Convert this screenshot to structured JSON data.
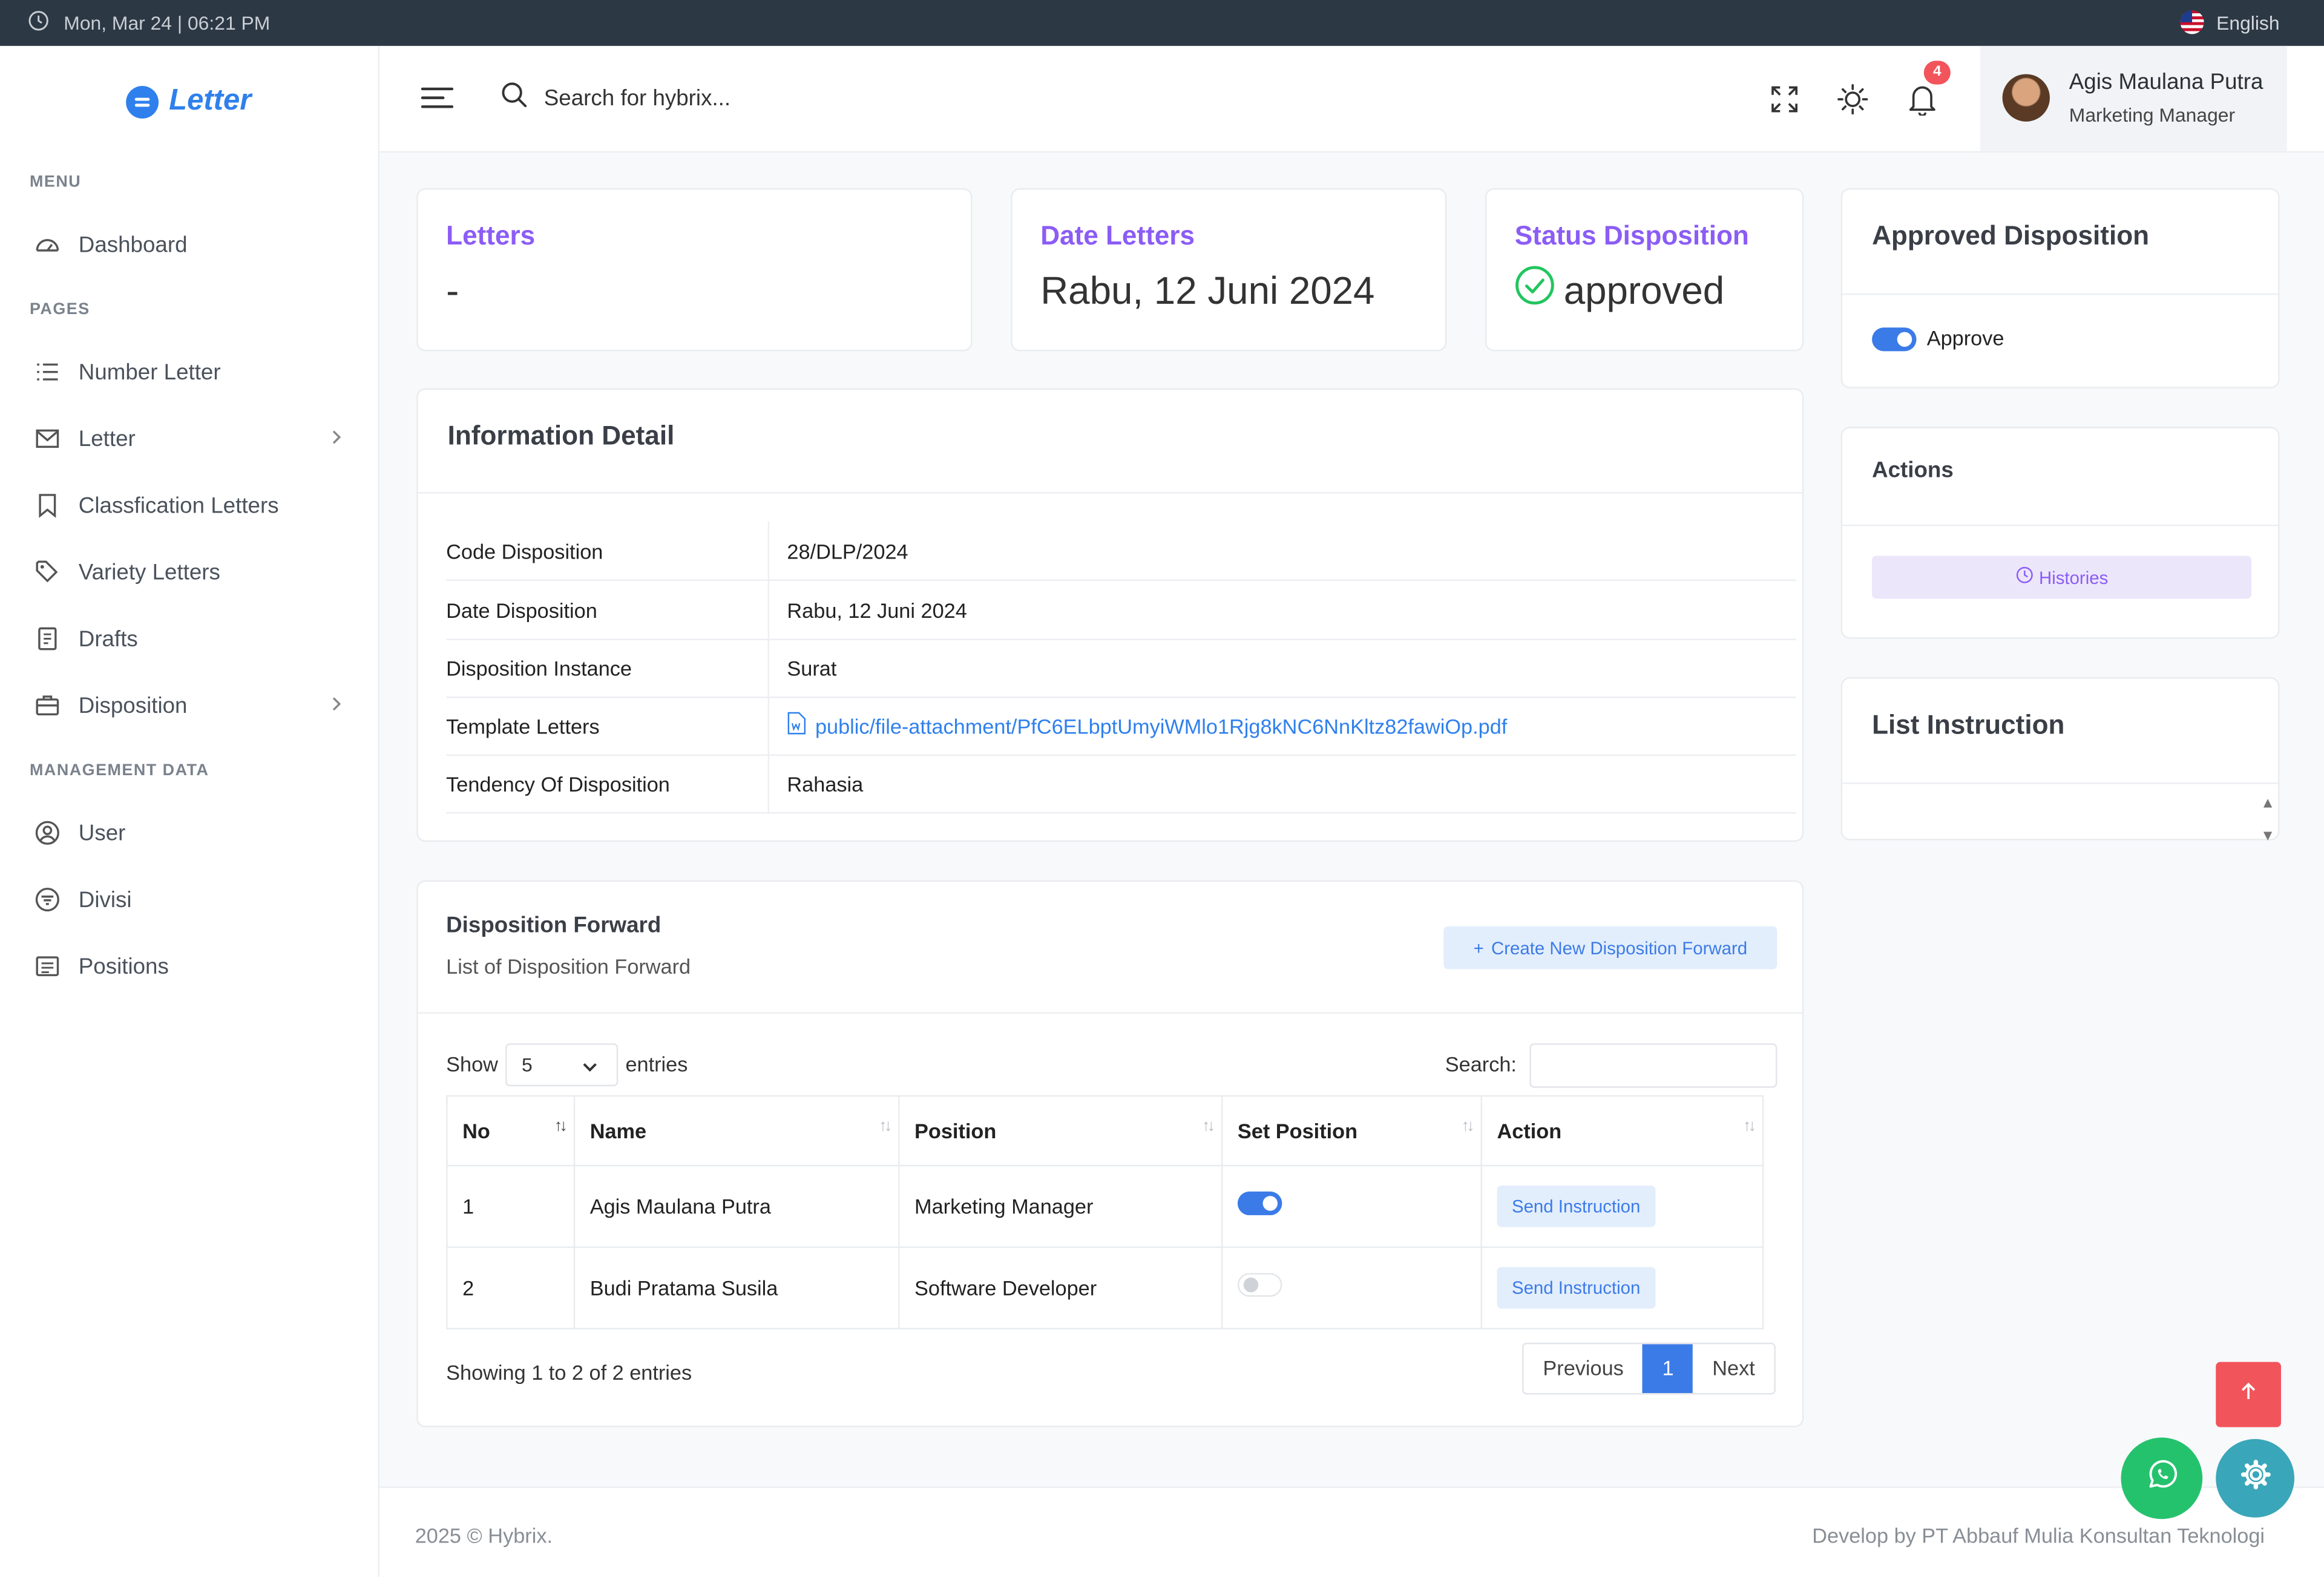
{
  "topbar": {
    "datetime": "Mon, Mar 24 | 06:21 PM",
    "language": "English"
  },
  "brand": {
    "name": "Letter"
  },
  "sidebar": {
    "sections": {
      "menu": "MENU",
      "pages": "PAGES",
      "management": "MANAGEMENT DATA"
    },
    "items": {
      "dashboard": "Dashboard",
      "number_letter": "Number Letter",
      "letter": "Letter",
      "classification": "Classfication Letters",
      "variety": "Variety Letters",
      "drafts": "Drafts",
      "disposition": "Disposition",
      "user": "User",
      "divisi": "Divisi",
      "positions": "Positions"
    }
  },
  "header": {
    "search_placeholder": "Search for hybrix...",
    "notification_count": "4",
    "user_name": "Agis Maulana Putra",
    "user_role": "Marketing Manager"
  },
  "stats": {
    "letters": {
      "label": "Letters",
      "value": "-"
    },
    "date": {
      "label": "Date Letters",
      "value": "Rabu, 12 Juni 2024"
    },
    "status": {
      "label": "Status Disposition",
      "value": "approved"
    }
  },
  "approved": {
    "title": "Approved Disposition",
    "toggle_label": "Approve",
    "toggle_on": true
  },
  "actions": {
    "title": "Actions",
    "histories": "Histories"
  },
  "instruction": {
    "title": "List Instruction"
  },
  "info": {
    "title": "Information Detail",
    "rows": [
      {
        "key": "Code Disposition",
        "value": "28/DLP/2024"
      },
      {
        "key": "Date Disposition",
        "value": "Rabu, 12 Juni 2024"
      },
      {
        "key": "Disposition Instance",
        "value": "Surat"
      },
      {
        "key": "Template Letters",
        "value": "public/file-attachment/PfC6ELbptUmyiWMlo1Rjg8kNC6NnKltz82fawiOp.pdf"
      },
      {
        "key": "Tendency Of Disposition",
        "value": "Rahasia"
      }
    ]
  },
  "forward": {
    "title": "Disposition Forward",
    "subtitle": "List of Disposition Forward",
    "create_button": "Create New Disposition Forward",
    "show_label": "Show",
    "entries_value": "5",
    "entries_label": "entries",
    "search_label": "Search:",
    "columns": [
      "No",
      "Name",
      "Position",
      "Set Position",
      "Action"
    ],
    "rows": [
      {
        "no": "1",
        "name": "Agis Maulana Putra",
        "position": "Marketing Manager",
        "set_position": true,
        "action": "Send Instruction"
      },
      {
        "no": "2",
        "name": "Budi Pratama Susila",
        "position": "Software Developer",
        "set_position": false,
        "action": "Send Instruction"
      }
    ],
    "info_text": "Showing 1 to 2 of 2 entries",
    "pager": {
      "previous": "Previous",
      "current": "1",
      "next": "Next"
    }
  },
  "footer": {
    "left": "2025 © Hybrix.",
    "right": "Develop by PT Abbauf Mulia Konsultan Teknologi"
  },
  "colors": {
    "primary": "#3b7be8",
    "accent": "#8b5cf6",
    "success": "#22c55e",
    "danger": "#f2545b",
    "whatsapp": "#25c26e",
    "settings": "#3aa6b9"
  }
}
